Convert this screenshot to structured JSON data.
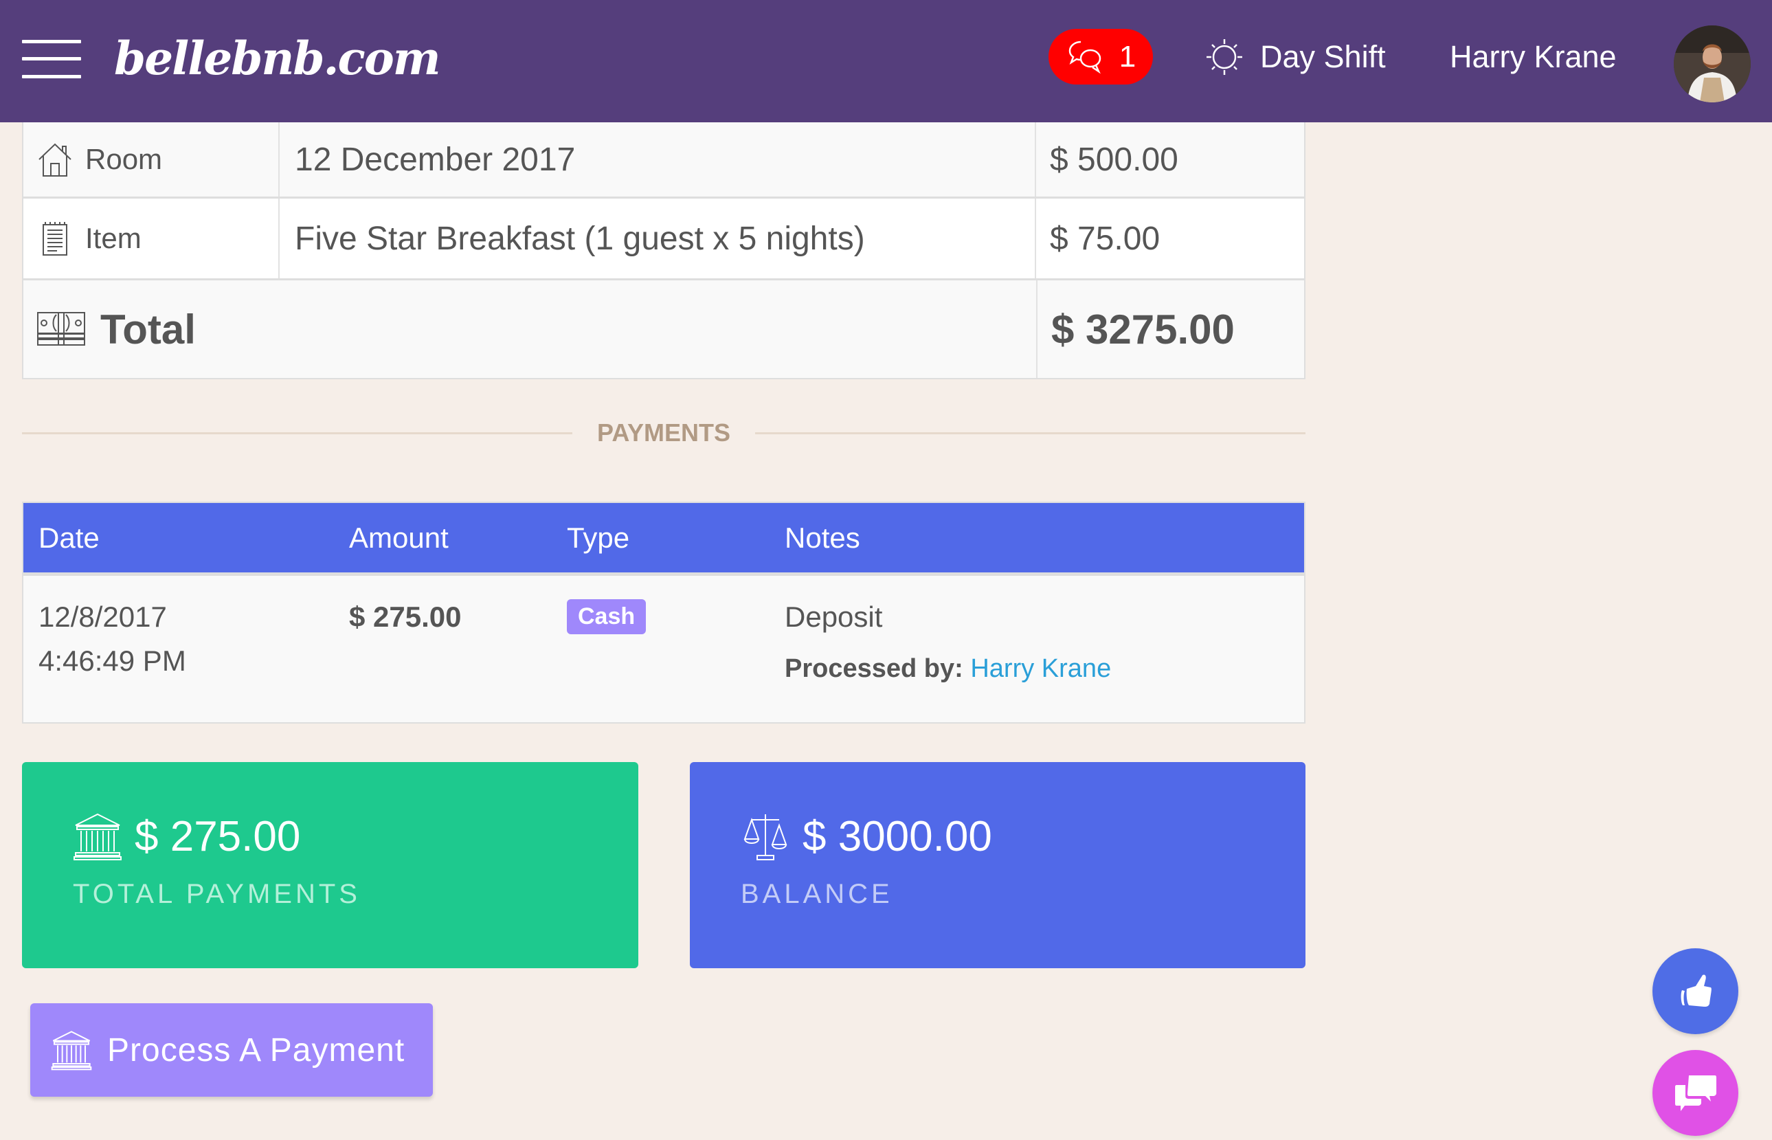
{
  "header": {
    "logo": "bellebnb.com",
    "messages_count": "1",
    "shift_label": "Day Shift",
    "user_name": "Harry Krane",
    "colors": {
      "bar": "#553e7c",
      "badge": "#ff0000"
    }
  },
  "charges": {
    "rows": [
      {
        "icon": "house-icon",
        "label": "Room",
        "description": "12 December 2017",
        "amount": "$ 500.00"
      },
      {
        "icon": "notepad-icon",
        "label": "Item",
        "description": "Five Star Breakfast (1 guest x 5 nights)",
        "amount": "$ 75.00"
      }
    ],
    "total": {
      "icon": "money-icon",
      "label": "Total",
      "amount": "$ 3275.00"
    }
  },
  "payments": {
    "section_title": "PAYMENTS",
    "columns": [
      "Date",
      "Amount",
      "Type",
      "Notes"
    ],
    "rows": [
      {
        "date": "12/8/2017 4:46:49 PM",
        "amount": "$ 275.00",
        "type": "Cash",
        "note": "Deposit",
        "processed_by_label": "Processed by:",
        "processed_by": "Harry Krane"
      }
    ],
    "header_color": "#5169e8"
  },
  "summary": {
    "total_payments": {
      "value": "$ 275.00",
      "caption": "TOTAL PAYMENTS",
      "color": "#1ec98e"
    },
    "balance": {
      "value": "$ 3000.00",
      "caption": "BALANCE",
      "color": "#5169e8"
    }
  },
  "actions": {
    "process_payment": "Process A Payment"
  },
  "fabs": {
    "like": {
      "icon": "thumbs-up-icon",
      "color": "#4f6de6"
    },
    "chat": {
      "icon": "chat-bubbles-icon",
      "color": "#e051e6"
    }
  }
}
